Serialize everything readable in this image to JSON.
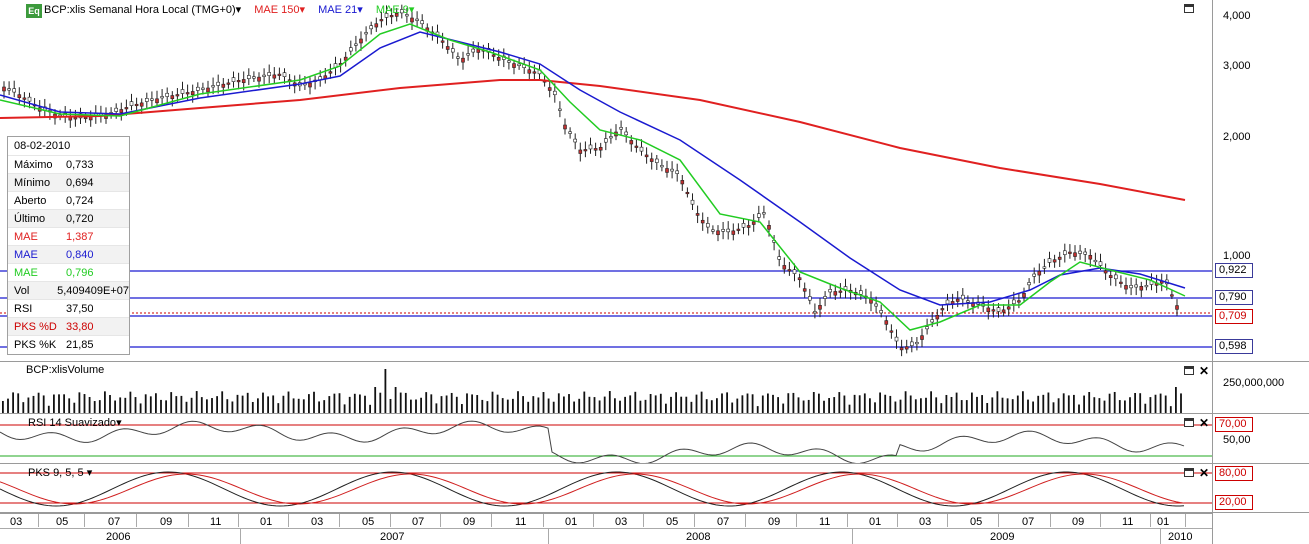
{
  "main": {
    "logo": "Eq",
    "title": "BCP:xlis Semanal Hora Local (TMG+0)",
    "title_dropdown": "▾",
    "legend": [
      {
        "label": "MAE 150",
        "arrow": "▾",
        "color": "#e02020"
      },
      {
        "label": "MAE 21",
        "arrow": "▾",
        "color": "#1a1ad0"
      },
      {
        "label": "MAE 9",
        "arrow": "▾",
        "color": "#22cc22"
      }
    ],
    "axis_ticks": [
      "4,000",
      "3,000",
      "2,000",
      "1,000"
    ],
    "price_tags": [
      "0,922",
      "0,790",
      "0,709",
      "0,598"
    ]
  },
  "info": {
    "date": "08-02-2010",
    "rows": [
      {
        "label": "Máximo",
        "value": "0,733",
        "color": "#000000"
      },
      {
        "label": "Mínimo",
        "value": "0,694",
        "color": "#000000"
      },
      {
        "label": "Aberto",
        "value": "0,724",
        "color": "#000000"
      },
      {
        "label": "Último",
        "value": "0,720",
        "color": "#000000"
      },
      {
        "label": "MAE",
        "value": "1,387",
        "color": "#e02020"
      },
      {
        "label": "MAE",
        "value": "0,840",
        "color": "#1a1ad0"
      },
      {
        "label": "MAE",
        "value": "0,796",
        "color": "#22cc22"
      },
      {
        "label": "Vol",
        "value": "5,409409E+07",
        "color": "#000000"
      },
      {
        "label": "RSI",
        "value": "37,50",
        "color": "#000000"
      },
      {
        "label": "PKS %D",
        "value": "33,80",
        "color": "#cc0000"
      },
      {
        "label": "PKS %K",
        "value": "21,85",
        "color": "#000000"
      }
    ]
  },
  "volume": {
    "title": "BCP:xlisVolume",
    "axis_tick": "250,000,000"
  },
  "rsi": {
    "title": "RSI 14 Suavizado",
    "title_dropdown": "▾",
    "axis_ticks": [
      "70,00",
      "50,00"
    ]
  },
  "pks": {
    "title": "PKS 9, 5, 5",
    "title_dropdown": "▾",
    "axis_ticks": [
      "80,00",
      "20,00"
    ]
  },
  "time_axis": {
    "months": [
      "03",
      "05",
      "07",
      "09",
      "11",
      "01",
      "03",
      "05",
      "07",
      "09",
      "11",
      "01",
      "03",
      "05",
      "07",
      "09",
      "11",
      "01",
      "03",
      "05",
      "07",
      "09",
      "11",
      "01"
    ],
    "years": [
      "2006",
      "2007",
      "2008",
      "2009",
      "2010"
    ]
  }
}
